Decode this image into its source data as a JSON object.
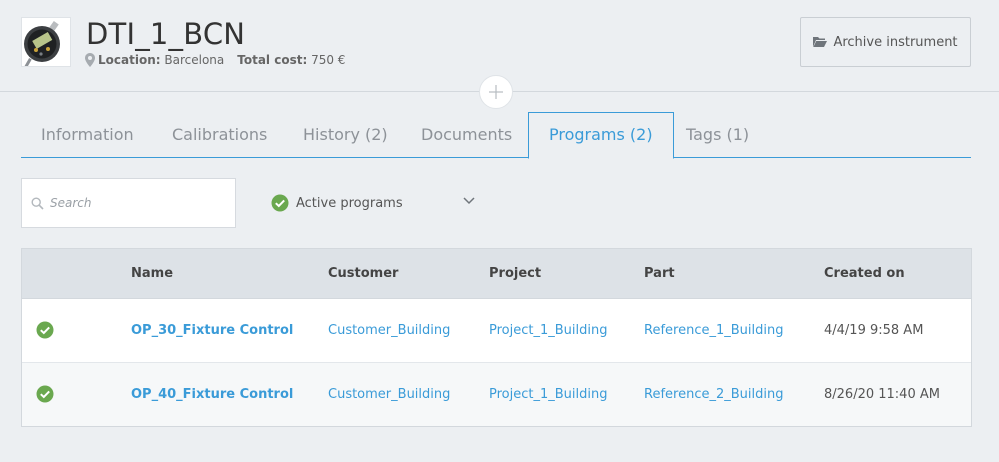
{
  "instrument": {
    "title": "DTI_1_BCN",
    "location_label": "Location:",
    "location_value": "Barcelona",
    "total_cost_label": "Total cost:",
    "total_cost_value": "750 €"
  },
  "header": {
    "archive_label": "Archive instrument"
  },
  "tabs": [
    {
      "label": "Information"
    },
    {
      "label": "Calibrations"
    },
    {
      "label": "History (2)"
    },
    {
      "label": "Documents"
    },
    {
      "label": "Programs (2)",
      "active": true
    },
    {
      "label": "Tags (1)"
    }
  ],
  "filters": {
    "search_placeholder": "Search",
    "status_label": "Active programs"
  },
  "table": {
    "columns": [
      "Name",
      "Customer",
      "Project",
      "Part",
      "Created on"
    ],
    "rows": [
      {
        "status": "active",
        "name": "OP_30_Fixture Control",
        "customer": "Customer_Building",
        "project": "Project_1_Building",
        "part": "Reference_1_Building",
        "created_on": "4/4/19 9:58 AM"
      },
      {
        "status": "active",
        "name": "OP_40_Fixture Control",
        "customer": "Customer_Building",
        "project": "Project_1_Building",
        "part": "Reference_2_Building",
        "created_on": "8/26/20 11:40 AM"
      }
    ]
  },
  "colors": {
    "accent": "#3a9bd8",
    "success": "#6aa84f",
    "background": "#eceff2"
  },
  "icons": {
    "location": "map-pin-icon",
    "archive": "folder-open-icon",
    "add": "plus-icon",
    "search": "search-icon",
    "status": "check-circle-icon",
    "dropdown": "chevron-down-icon"
  }
}
